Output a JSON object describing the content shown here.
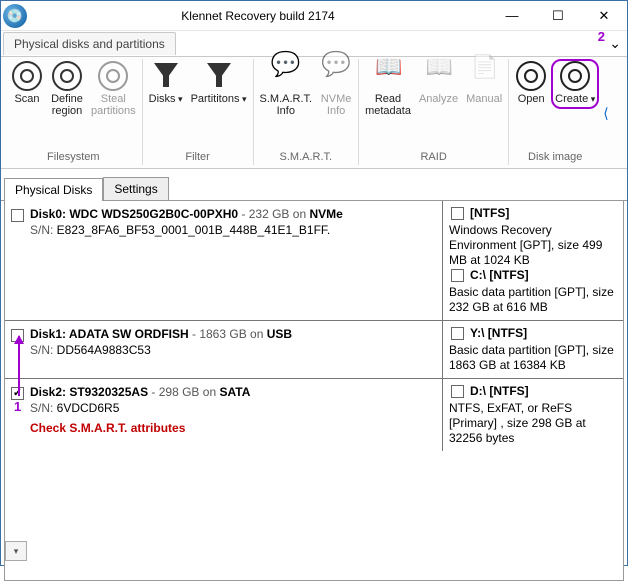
{
  "window": {
    "title": "Klennet Recovery build 2174"
  },
  "ribbon_tab": "Physical disks and partitions",
  "annotations": {
    "a1": "1",
    "a2": "2"
  },
  "ribbon": {
    "filesystem": {
      "scan": "Scan",
      "define": "Define\nregion",
      "steal": "Steal\npartitions",
      "label": "Filesystem"
    },
    "filter": {
      "disks": "Disks",
      "parts": "Partititons",
      "label": "Filter"
    },
    "smart": {
      "info": "S.M.A.R.T.\nInfo",
      "nvme": "NVMe\nInfo",
      "label": "S.M.A.R.T."
    },
    "raid": {
      "read": "Read\nmetadata",
      "analyze": "Analyze",
      "manual": "Manual",
      "label": "RAID"
    },
    "image": {
      "open": "Open",
      "create": "Create",
      "label": "Disk image"
    }
  },
  "subtabs": {
    "disks": "Physical Disks",
    "settings": "Settings"
  },
  "disks": [
    {
      "title_a": "Disk0:  WDC WDS250G2B0C-00PXH0",
      "size": "  -  232 GB",
      "bus": "NVMe",
      "sn_label": "S/N:",
      "sn": "E823_8FA6_BF53_0001_001B_448B_41E1_B1FF.",
      "checked": false,
      "smart": "",
      "partitions": [
        {
          "drive": "",
          "fs": "[NTFS]",
          "desc": "Windows Recovery Environment [GPT], size 499 MB at 1024 KB"
        },
        {
          "drive": "C:\\ ",
          "fs": "[NTFS]",
          "desc": "Basic data partition [GPT], size 232 GB at 616 MB"
        }
      ]
    },
    {
      "title_a": "Disk1: ADATA SW ORDFISH",
      "size": "  -  1863 GB",
      "bus": "USB",
      "sn_label": "S/N:",
      "sn": "DD564A9883C53",
      "checked": false,
      "smart": "",
      "partitions": [
        {
          "drive": "Y:\\ ",
          "fs": "[NTFS]",
          "desc": "Basic data partition [GPT], size 1863 GB at 16384 KB"
        }
      ]
    },
    {
      "title_a": "Disk2:  ST9320325AS",
      "size": "  -  298 GB",
      "bus": "SATA",
      "sn_label": "S/N:",
      "sn": "6VDCD6R5",
      "checked": true,
      "smart": "Check S.M.A.R.T. attributes",
      "partitions": [
        {
          "drive": "D:\\ ",
          "fs": "[NTFS]",
          "desc": "NTFS, ExFAT, or ReFS [Primary] , size 298 GB at 32256 bytes"
        }
      ]
    }
  ]
}
